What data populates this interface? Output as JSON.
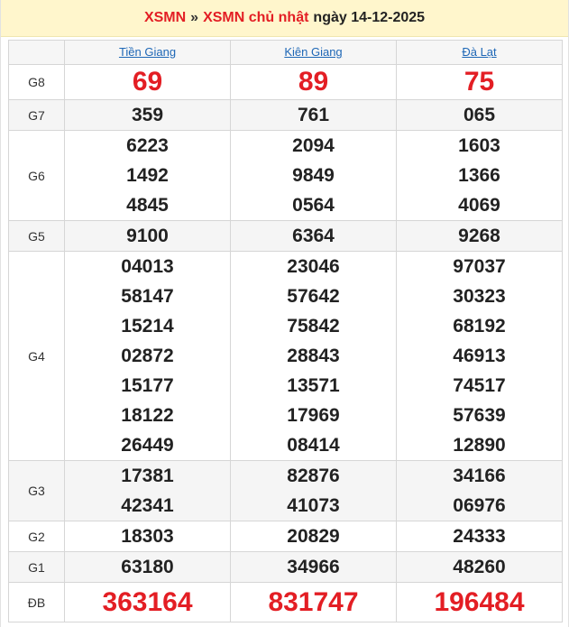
{
  "header": {
    "link1": "XSMN",
    "separator": "»",
    "link2": "XSMN chủ nhật",
    "date": "ngày 14-12-2025"
  },
  "provinces": [
    "Tiền Giang",
    "Kiên Giang",
    "Đà Lạt"
  ],
  "rows": [
    {
      "label": "G8",
      "values": [
        [
          "69"
        ],
        [
          "89"
        ],
        [
          "75"
        ]
      ]
    },
    {
      "label": "G7",
      "values": [
        [
          "359"
        ],
        [
          "761"
        ],
        [
          "065"
        ]
      ]
    },
    {
      "label": "G6",
      "values": [
        [
          "6223",
          "1492",
          "4845"
        ],
        [
          "2094",
          "9849",
          "0564"
        ],
        [
          "1603",
          "1366",
          "4069"
        ]
      ]
    },
    {
      "label": "G5",
      "values": [
        [
          "9100"
        ],
        [
          "6364"
        ],
        [
          "9268"
        ]
      ]
    },
    {
      "label": "G4",
      "values": [
        [
          "04013",
          "58147",
          "15214",
          "02872",
          "15177",
          "18122",
          "26449"
        ],
        [
          "23046",
          "57642",
          "75842",
          "28843",
          "13571",
          "17969",
          "08414"
        ],
        [
          "97037",
          "30323",
          "68192",
          "46913",
          "74517",
          "57639",
          "12890"
        ]
      ]
    },
    {
      "label": "G3",
      "values": [
        [
          "17381",
          "42341"
        ],
        [
          "82876",
          "41073"
        ],
        [
          "34166",
          "06976"
        ]
      ]
    },
    {
      "label": "G2",
      "values": [
        [
          "18303"
        ],
        [
          "20829"
        ],
        [
          "24333"
        ]
      ]
    },
    {
      "label": "G1",
      "values": [
        [
          "63180"
        ],
        [
          "34966"
        ],
        [
          "48260"
        ]
      ]
    },
    {
      "label": "ĐB",
      "values": [
        [
          "363164"
        ],
        [
          "831747"
        ],
        [
          "196484"
        ]
      ]
    }
  ]
}
